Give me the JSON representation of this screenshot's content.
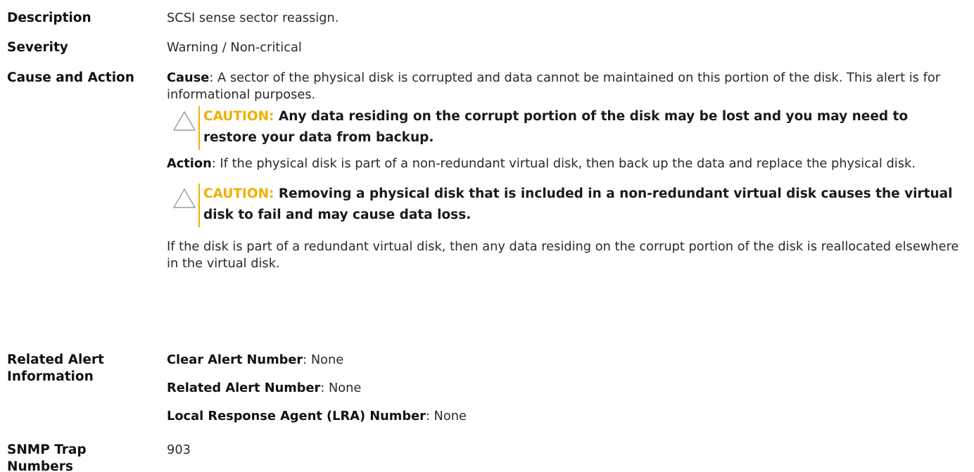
{
  "rows": {
    "description": {
      "term": "Description",
      "value": "SCSI sense sector reassign."
    },
    "severity": {
      "term": "Severity",
      "value": "Warning / Non-critical"
    },
    "cause_action": {
      "term": "Cause and Action",
      "cause_label": "Cause",
      "cause_text": ": A sector of the physical disk is corrupted and data cannot be maintained on this portion of the disk. This alert is for informational purposes.",
      "caution1_label": "CAUTION:",
      "caution1_text": " Any data residing on the corrupt portion of the disk may be lost and you may need to restore your data from backup.",
      "action_label": "Action",
      "action_text": ": If the physical disk is part of a non-redundant virtual disk, then back up the data and replace the physical disk.",
      "caution2_label": "CAUTION:",
      "caution2_text": " Removing a physical disk that is included in a non-redundant virtual disk causes the virtual disk to fail and may cause data loss.",
      "redundant_text": "If the disk is part of a redundant virtual disk, then any data residing on the corrupt portion of the disk is reallocated elsewhere in the virtual disk."
    },
    "related": {
      "term_line1": "Related Alert",
      "term_line2": "Information",
      "clear_label": "Clear Alert Number",
      "clear_value": ": None",
      "related_label": "Related Alert Number",
      "related_value": ": None",
      "lra_label": "Local Response Agent (LRA) Number",
      "lra_value": ": None"
    },
    "snmp": {
      "term_line1": "SNMP Trap",
      "term_line2": "Numbers",
      "value": "903"
    }
  },
  "colors": {
    "caution_accent": "#f0b000",
    "text": "#1a1a1a"
  },
  "icons": {
    "caution": "warning-triangle-icon"
  }
}
